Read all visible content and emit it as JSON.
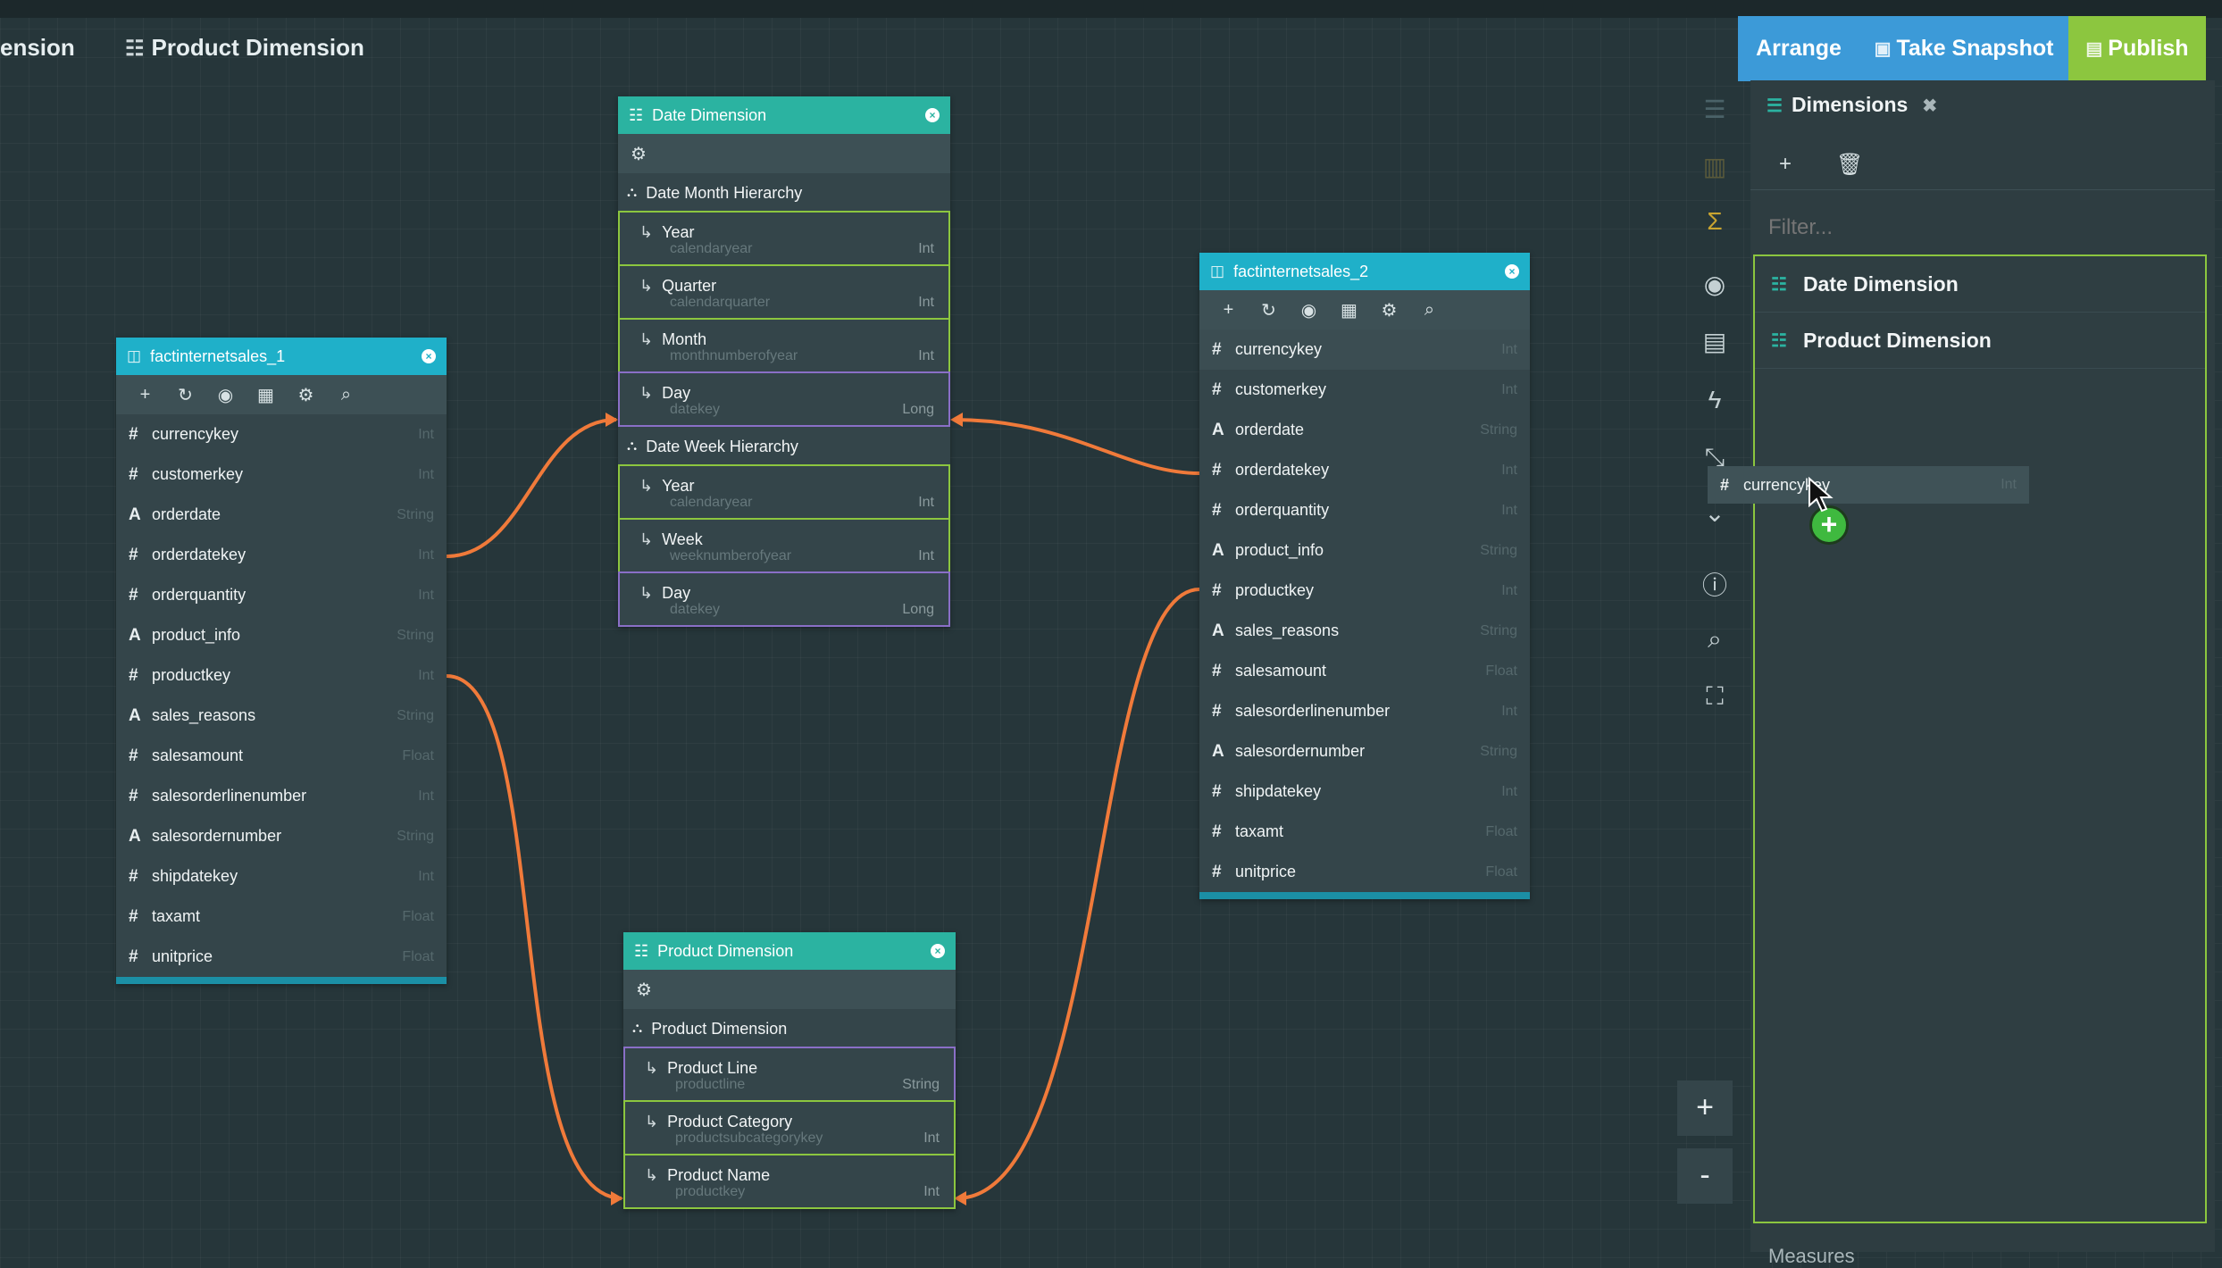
{
  "tabs": [
    {
      "label": "ension"
    },
    {
      "label": "Product Dimension",
      "icon": "table-icon"
    }
  ],
  "toolbar": {
    "arrange": "Arrange",
    "snapshot": "Take Snapshot",
    "publish": "Publish"
  },
  "colors": {
    "accent_blue": "#3c9ad8",
    "accent_green": "#8cc63f",
    "teal": "#1fb0c9",
    "link_orange": "#f07a3a",
    "level_border_green": "#8cc63f",
    "level_border_purple": "#8a6fc7"
  },
  "fact1": {
    "title": "factinternetsales_1",
    "fields": [
      {
        "name": "currencykey",
        "type": "Int",
        "icon": "#"
      },
      {
        "name": "customerkey",
        "type": "Int",
        "icon": "#"
      },
      {
        "name": "orderdate",
        "type": "String",
        "icon": "A"
      },
      {
        "name": "orderdatekey",
        "type": "Int",
        "icon": "#"
      },
      {
        "name": "orderquantity",
        "type": "Int",
        "icon": "#"
      },
      {
        "name": "product_info",
        "type": "String",
        "icon": "A"
      },
      {
        "name": "productkey",
        "type": "Int",
        "icon": "#"
      },
      {
        "name": "sales_reasons",
        "type": "String",
        "icon": "A"
      },
      {
        "name": "salesamount",
        "type": "Float",
        "icon": "#"
      },
      {
        "name": "salesorderlinenumber",
        "type": "Int",
        "icon": "#"
      },
      {
        "name": "salesordernumber",
        "type": "String",
        "icon": "A"
      },
      {
        "name": "shipdatekey",
        "type": "Int",
        "icon": "#"
      },
      {
        "name": "taxamt",
        "type": "Float",
        "icon": "#"
      },
      {
        "name": "unitprice",
        "type": "Float",
        "icon": "#"
      }
    ]
  },
  "fact2": {
    "title": "factinternetsales_2",
    "fields": [
      {
        "name": "currencykey",
        "type": "Int",
        "icon": "#"
      },
      {
        "name": "customerkey",
        "type": "Int",
        "icon": "#"
      },
      {
        "name": "orderdate",
        "type": "String",
        "icon": "A"
      },
      {
        "name": "orderdatekey",
        "type": "Int",
        "icon": "#"
      },
      {
        "name": "orderquantity",
        "type": "Int",
        "icon": "#"
      },
      {
        "name": "product_info",
        "type": "String",
        "icon": "A"
      },
      {
        "name": "productkey",
        "type": "Int",
        "icon": "#"
      },
      {
        "name": "sales_reasons",
        "type": "String",
        "icon": "A"
      },
      {
        "name": "salesamount",
        "type": "Float",
        "icon": "#"
      },
      {
        "name": "salesorderlinenumber",
        "type": "Int",
        "icon": "#"
      },
      {
        "name": "salesordernumber",
        "type": "String",
        "icon": "A"
      },
      {
        "name": "shipdatekey",
        "type": "Int",
        "icon": "#"
      },
      {
        "name": "taxamt",
        "type": "Float",
        "icon": "#"
      },
      {
        "name": "unitprice",
        "type": "Float",
        "icon": "#"
      }
    ]
  },
  "date_dim": {
    "title": "Date Dimension",
    "hierarchies": [
      {
        "name": "Date Month Hierarchy",
        "levels": [
          {
            "name": "Year",
            "key": "calendaryear",
            "type": "Int",
            "border": "green"
          },
          {
            "name": "Quarter",
            "key": "calendarquarter",
            "type": "Int",
            "border": "green"
          },
          {
            "name": "Month",
            "key": "monthnumberofyear",
            "type": "Int",
            "border": "green"
          },
          {
            "name": "Day",
            "key": "datekey",
            "type": "Long",
            "border": "purple"
          }
        ]
      },
      {
        "name": "Date Week Hierarchy",
        "levels": [
          {
            "name": "Year",
            "key": "calendaryear",
            "type": "Int",
            "border": "green"
          },
          {
            "name": "Week",
            "key": "weeknumberofyear",
            "type": "Int",
            "border": "green"
          },
          {
            "name": "Day",
            "key": "datekey",
            "type": "Long",
            "border": "purple"
          }
        ]
      }
    ]
  },
  "product_dim": {
    "title": "Product Dimension",
    "hierarchies": [
      {
        "name": "Product Dimension",
        "levels": [
          {
            "name": "Product Line",
            "key": "productline",
            "type": "String",
            "border": "purple"
          },
          {
            "name": "Product Category",
            "key": "productsubcategorykey",
            "type": "Int",
            "border": "green"
          },
          {
            "name": "Product Name",
            "key": "productkey",
            "type": "Int",
            "border": "green"
          }
        ]
      }
    ]
  },
  "panel": {
    "title": "Dimensions",
    "filter_placeholder": "Filter...",
    "items": [
      "Date Dimension",
      "Product Dimension"
    ],
    "measures_label": "Measures"
  },
  "drag": {
    "field": "currencykey",
    "type": "Int"
  },
  "zoom": {
    "in": "+",
    "out": "-"
  }
}
